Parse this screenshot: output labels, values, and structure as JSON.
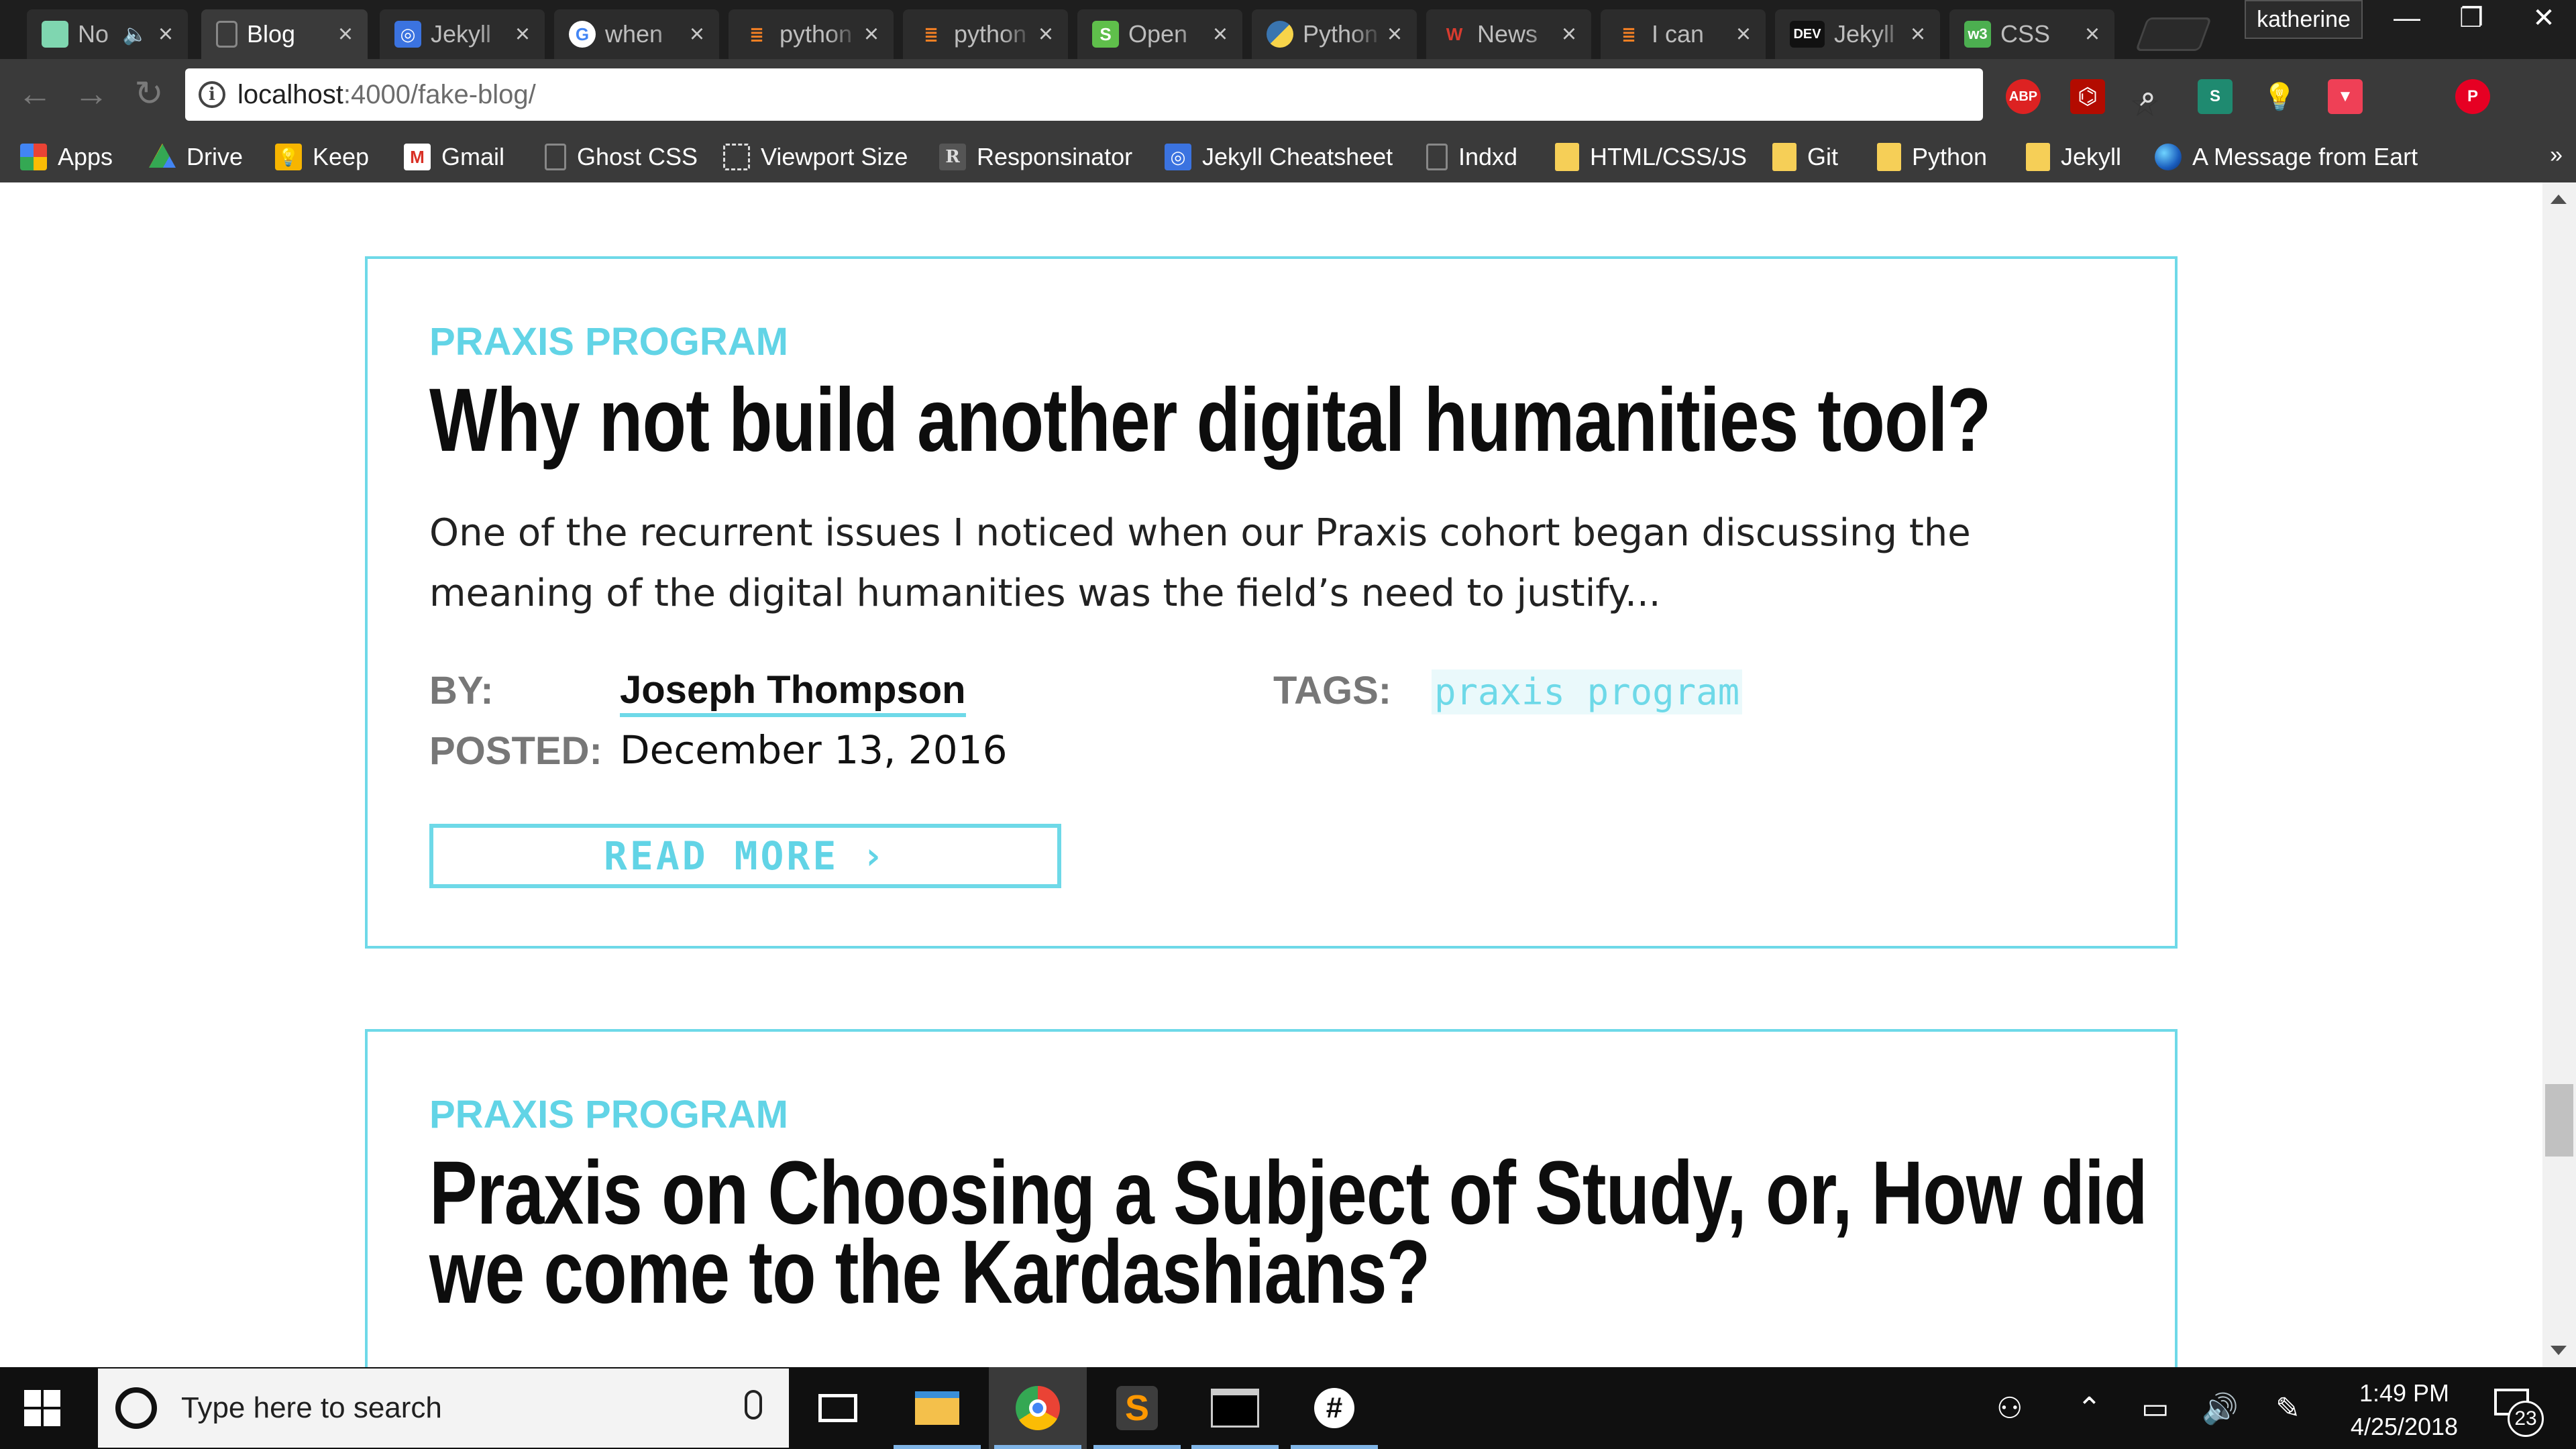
{
  "browser": {
    "tabs": [
      {
        "title": "No",
        "favicon": "note-favicon",
        "color": "#7fd6b0",
        "muted": true
      },
      {
        "title": "Blog",
        "favicon": "page-favicon",
        "color": "#555555",
        "active": true
      },
      {
        "title": "Jekyll",
        "favicon": "jekyll-favicon",
        "color": "#3b73e0"
      },
      {
        "title": "when",
        "favicon": "google-favicon",
        "color": "#ffffff"
      },
      {
        "title": "python",
        "favicon": "stackoverflow-favicon",
        "color": "#f48024"
      },
      {
        "title": "python",
        "favicon": "stackoverflow-favicon",
        "color": "#f48024"
      },
      {
        "title": "Open",
        "favicon": "shopify-favicon",
        "color": "#5fbf4b"
      },
      {
        "title": "Python",
        "favicon": "python-favicon",
        "color": "#3a75b0"
      },
      {
        "title": "News",
        "favicon": "w-favicon",
        "color": "#d83b2f"
      },
      {
        "title": "I can",
        "favicon": "stackoverflow-favicon",
        "color": "#f48024"
      },
      {
        "title": "Jekyll",
        "favicon": "dev-favicon",
        "color": "#111111"
      },
      {
        "title": "CSS",
        "favicon": "w3-favicon",
        "color": "#4caf50"
      }
    ],
    "profile_name": "katherine",
    "address": {
      "host": "localhost",
      "path": ":4000/fake-blog/"
    },
    "bookmarks": [
      {
        "label": "Apps",
        "icon": "apps-grid-icon"
      },
      {
        "label": "Drive",
        "icon": "drive-icon"
      },
      {
        "label": "Keep",
        "icon": "keep-icon"
      },
      {
        "label": "Gmail",
        "icon": "gmail-icon"
      },
      {
        "label": "Ghost CSS",
        "icon": "page-icon"
      },
      {
        "label": "Viewport Size",
        "icon": "viewport-icon"
      },
      {
        "label": "Responsinator",
        "icon": "responsinator-icon"
      },
      {
        "label": "Jekyll Cheatsheet",
        "icon": "jekyll-icon"
      },
      {
        "label": "Indxd",
        "icon": "page-icon"
      },
      {
        "label": "HTML/CSS/JS",
        "icon": "folder-icon"
      },
      {
        "label": "Git",
        "icon": "folder-icon"
      },
      {
        "label": "Python",
        "icon": "folder-icon"
      },
      {
        "label": "Jekyll",
        "icon": "folder-icon"
      },
      {
        "label": "A Message from Eart",
        "icon": "globe-icon"
      }
    ],
    "bookmarks_more": "»",
    "extensions": [
      "abp-icon",
      "pdf-icon",
      "lens-icon",
      "s-icon",
      "bulb-icon",
      "pocket-icon",
      "pinterest-icon"
    ],
    "abp_label": "ABP"
  },
  "posts": [
    {
      "category": "PRAXIS PROGRAM",
      "title": "Why not build another digital humanities tool?",
      "excerpt_line1": "One of the recurrent issues I noticed when our Praxis cohort began discussing the",
      "excerpt_line2": "meaning of the digital humanities was the field’s need to justify...",
      "by_label": "BY:",
      "author": "Joseph Thompson",
      "posted_label": "POSTED:",
      "date": "December 13, 2016",
      "tags_label": "TAGS:",
      "tag": "praxis program",
      "read_more": "READ MORE"
    },
    {
      "category": "PRAXIS PROGRAM",
      "title_line1": "Praxis on Choosing a Subject of Study, or, How did",
      "title_line2": "we come to the Kardashians?"
    }
  ],
  "taskbar": {
    "search_placeholder": "Type here to search",
    "apps": [
      "task-view-icon",
      "file-explorer-icon",
      "chrome-icon",
      "sublime-icon",
      "terminal-icon",
      "slack-icon"
    ],
    "time": "1:49 PM",
    "date": "4/25/2018",
    "notification_count": "23"
  },
  "colors": {
    "accent": "#6ed9e8",
    "accent_text": "#62d4e6",
    "chrome_dark": "#3a3a3a",
    "taskbar": "#101010"
  }
}
